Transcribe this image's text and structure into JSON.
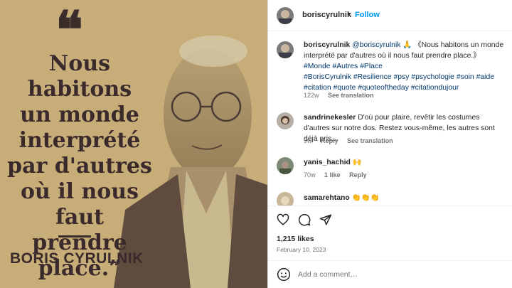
{
  "post_image": {
    "quote_mark": "❝",
    "quote_lines": "Nous habitons\nun monde\ninterprété\npar d'autres\noù il nous faut\nprendre\nplace.”",
    "author": "BORIS CYRULNIK"
  },
  "header": {
    "username": "boriscyrulnik",
    "separator": "•",
    "follow": "Follow"
  },
  "caption": {
    "username": "boriscyrulnik",
    "mention": "@boriscyrulnik",
    "emoji": "🙏",
    "text": "《Nous habitons un monde interprété par d'autres où il nous faut prendre place.》",
    "hashtags_1": "#Monde #Autres #Place",
    "hashtags_2": "#BorisCyrulnik #Resilience #psy #psychologie #soin #aide",
    "hashtags_3": "#citation #quote #quoteoftheday #citationdujour",
    "time": "122w",
    "see_translation": "See translation"
  },
  "comments": [
    {
      "username": "sandrinekesler",
      "text": "D'où pour plaire, revêtir les costumes d'autres sur notre dos. Restez vous-même, les autres sont déjà pris...",
      "time": "9w",
      "reply": "Reply",
      "see_translation": "See translation"
    },
    {
      "username": "yanis_hachid",
      "text": "🙌",
      "time": "70w",
      "likes": "1 like",
      "reply": "Reply"
    },
    {
      "username": "samarehtano",
      "text": "👏👏👏"
    }
  ],
  "likes": "1,215 likes",
  "date": "February 10, 2023",
  "add_comment_placeholder": "Add a comment…",
  "icons": {
    "like": "heart-icon",
    "comment": "comment-icon",
    "share": "share-icon",
    "emoji": "emoji-icon"
  },
  "colors": {
    "link_blue": "#0095f6",
    "hashtag": "#00376b",
    "image_background": "#c7ae79",
    "quote_text": "#3b2a2c"
  }
}
